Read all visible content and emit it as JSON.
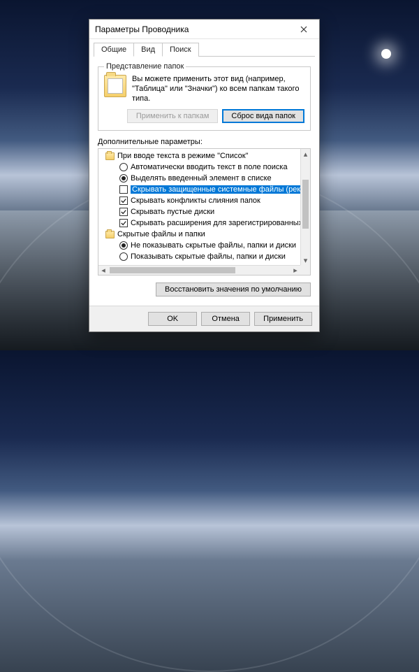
{
  "window": {
    "title": "Параметры Проводника"
  },
  "tabs": {
    "general": "Общие",
    "view": "Вид",
    "search": "Поиск"
  },
  "folderViews": {
    "legend": "Представление папок",
    "desc": "Вы можете применить этот вид (например, \"Таблица\" или \"Значки\") ко всем папкам такого типа.",
    "applyBtn": "Применить к папкам",
    "resetBtn": "Сброс вида папок"
  },
  "advanced": {
    "label": "Дополнительные параметры:",
    "restoreBtn": "Восстановить значения по умолчанию",
    "items": [
      {
        "kind": "group",
        "text": "При вводе текста в режиме \"Список\""
      },
      {
        "kind": "radio",
        "checked": false,
        "text": "Автоматически вводить текст в поле поиска"
      },
      {
        "kind": "radio",
        "checked": true,
        "text": "Выделять введенный элемент в списке"
      },
      {
        "kind": "check",
        "checked": false,
        "selected": true,
        "text": "Скрывать защищенные системные файлы (рекомендуется)"
      },
      {
        "kind": "check",
        "checked": true,
        "text": "Скрывать конфликты слияния папок"
      },
      {
        "kind": "check",
        "checked": true,
        "text": "Скрывать пустые диски"
      },
      {
        "kind": "check",
        "checked": true,
        "text": "Скрывать расширения для зарегистрированных типов"
      },
      {
        "kind": "group",
        "text": "Скрытые файлы и папки"
      },
      {
        "kind": "radio",
        "checked": true,
        "text": "Не показывать скрытые файлы, папки и диски"
      },
      {
        "kind": "radio",
        "checked": false,
        "text": "Показывать скрытые файлы, папки и диски"
      }
    ]
  },
  "dialogButtons": {
    "ok": "OK",
    "cancel": "Отмена",
    "apply": "Применить"
  }
}
